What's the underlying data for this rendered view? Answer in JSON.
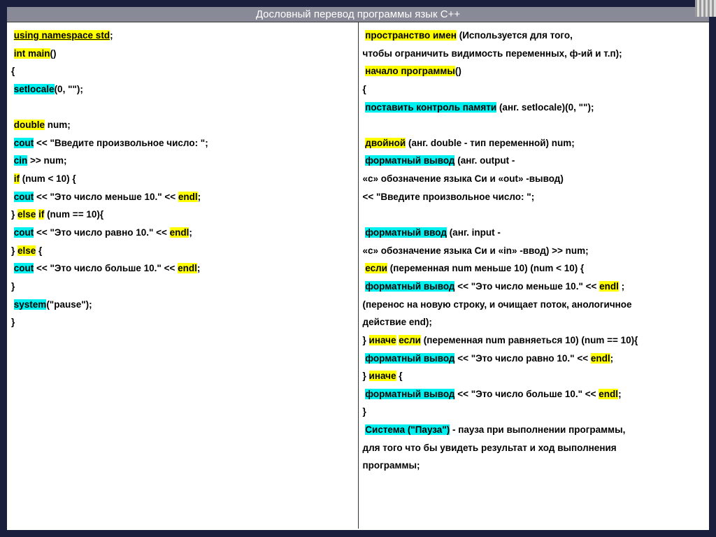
{
  "header": {
    "title": "Дословный перевод программы язык C++"
  },
  "left": {
    "lines": [
      [
        {
          "t": "  ",
          "y": true
        }
      ],
      [
        {
          "t": "  ",
          "y": true
        }
      ],
      [
        {
          "t": " "
        },
        {
          "t": "using namespace std",
          "y": true,
          "b": true,
          "u": true
        },
        {
          "t": ";",
          "b": true
        }
      ],
      [
        {
          "t": " "
        },
        {
          "t": "int main",
          "y": true,
          "b": true
        },
        {
          "t": "()",
          "b": true
        }
      ],
      [
        {
          "t": "{",
          "b": true
        }
      ],
      [
        {
          "t": "  "
        },
        {
          "t": "setlocale",
          "c": true,
          "b": true
        },
        {
          "t": "(0, \"\");",
          "b": true
        }
      ],
      [
        {
          "t": " "
        }
      ],
      [
        {
          "t": " "
        },
        {
          "t": "double",
          "y": true,
          "b": true
        },
        {
          "t": " num;",
          "b": true
        }
      ],
      [
        {
          "t": " "
        },
        {
          "t": "cout",
          "c": true,
          "b": true
        },
        {
          "t": " << \"Введите произвольное число: \";",
          "b": true
        }
      ],
      [
        {
          "t": " "
        },
        {
          "t": "cin",
          "c": true,
          "b": true
        },
        {
          "t": " >> num;",
          "b": true
        }
      ],
      [
        {
          "t": " "
        },
        {
          "t": "if",
          "y": true,
          "b": true
        },
        {
          "t": " (num < 10) {",
          "b": true
        }
      ],
      [
        {
          "t": " "
        },
        {
          "t": "cout",
          "c": true,
          "b": true
        },
        {
          "t": " << \"Это число меньше 10.\" << ",
          "b": true
        },
        {
          "t": "endl",
          "y": true,
          "b": true
        },
        {
          "t": ";",
          "b": true
        }
      ],
      [
        {
          "t": "} ",
          "b": true
        },
        {
          "t": "else",
          "y": true,
          "b": true
        },
        {
          "t": " ",
          "b": true
        },
        {
          "t": "if",
          "y": true,
          "b": true
        },
        {
          "t": " (num == 10){",
          "b": true
        }
      ],
      [
        {
          "t": " "
        },
        {
          "t": "cout",
          "c": true,
          "b": true
        },
        {
          "t": " << \"Это число равно 10.\" << ",
          "b": true
        },
        {
          "t": "endl",
          "y": true,
          "b": true
        },
        {
          "t": ";",
          "b": true
        }
      ],
      [
        {
          "t": "} ",
          "b": true
        },
        {
          "t": "else",
          "y": true,
          "b": true
        },
        {
          "t": " {",
          "b": true
        }
      ],
      [
        {
          "t": "   "
        },
        {
          "t": "cout",
          "c": true,
          "b": true
        },
        {
          "t": " << \"Это число больше 10.\" << ",
          "b": true
        },
        {
          "t": "endl",
          "y": true,
          "b": true
        },
        {
          "t": ";",
          "b": true
        }
      ],
      [
        {
          "t": "}",
          "b": true
        }
      ],
      [
        {
          "t": "  "
        },
        {
          "t": "system",
          "c": true,
          "b": true
        },
        {
          "t": "(\"pause\");",
          "b": true
        }
      ],
      [
        {
          "t": "}",
          "b": true
        }
      ]
    ]
  },
  "right": {
    "lines": [
      [
        {
          "t": "  ",
          "y": true
        }
      ],
      [
        {
          "t": " "
        },
        {
          "t": "пространство имен",
          "y": true,
          "b": true
        },
        {
          "t": " (Используется для того,",
          "b": true
        }
      ],
      [
        {
          "t": " чтобы ограничить видимость переменных, ф-ий и т.п);",
          "b": true
        }
      ],
      [
        {
          "t": " "
        },
        {
          "t": "начало программы",
          "y": true,
          "b": true
        },
        {
          "t": "()",
          "b": true
        }
      ],
      [
        {
          "t": "{",
          "b": true
        }
      ],
      [
        {
          "t": "  "
        },
        {
          "t": "поставить контроль памяти",
          "c": true,
          "b": true
        },
        {
          "t": " (анг. setlocale)(0, \"\");",
          "b": true
        }
      ],
      [
        {
          "t": " "
        }
      ],
      [
        {
          "t": " "
        },
        {
          "t": "двойной",
          "y": true,
          "b": true
        },
        {
          "t": " (анг. double - тип переменной) num;",
          "b": true
        }
      ],
      [
        {
          "t": "  "
        },
        {
          "t": "форматный вывод",
          "c": true,
          "b": true
        },
        {
          "t": " (анг. output -",
          "b": true
        }
      ],
      [
        {
          "t": " «с» обозначение языка Си и «out» -вывод)",
          "b": true
        }
      ],
      [
        {
          "t": " << \"Введите произвольное число: \";",
          "b": true
        }
      ],
      [
        {
          "t": " "
        }
      ],
      [
        {
          "t": " "
        },
        {
          "t": "форматный ввод",
          "c": true,
          "b": true
        },
        {
          "t": " (анг. input -",
          "b": true
        }
      ],
      [
        {
          "t": " «с» обозначение языка Си и «in» -ввод) >> num;",
          "b": true
        }
      ],
      [
        {
          "t": "  "
        },
        {
          "t": "если",
          "y": true,
          "b": true
        },
        {
          "t": " (переменная num меньше 10) (num < 10) {",
          "b": true
        }
      ],
      [
        {
          "t": "  "
        },
        {
          "t": "форматный вывод",
          "c": true,
          "b": true
        },
        {
          "t": " << \"Это число меньше 10.\" << ",
          "b": true
        },
        {
          "t": "endl",
          "y": true,
          "b": true
        },
        {
          "t": " ;",
          "b": true
        }
      ],
      [
        {
          "t": "(перенос на новую строку, и очищает поток, анологичное",
          "b": true
        }
      ],
      [
        {
          "t": "действие end);",
          "b": true
        }
      ],
      [
        {
          "t": " } ",
          "b": true
        },
        {
          "t": "иначе",
          "y": true,
          "b": true
        },
        {
          "t": " ",
          "b": true
        },
        {
          "t": "если",
          "y": true,
          "b": true
        },
        {
          "t": " (переменная num равняеться 10) (num == 10){",
          "b": true
        }
      ],
      [
        {
          "t": "   "
        },
        {
          "t": "форматный вывод",
          "c": true,
          "b": true
        },
        {
          "t": " << \"Это число равно 10.\" << ",
          "b": true
        },
        {
          "t": "endl",
          "y": true,
          "b": true
        },
        {
          "t": ";",
          "b": true
        }
      ],
      [
        {
          "t": "} ",
          "b": true
        },
        {
          "t": "иначе",
          "y": true,
          "b": true
        },
        {
          "t": " {",
          "b": true
        }
      ],
      [
        {
          "t": "   "
        },
        {
          "t": "форматный вывод",
          "c": true,
          "b": true
        },
        {
          "t": " << \"Это число больше 10.\" << ",
          "b": true
        },
        {
          "t": "endl",
          "y": true,
          "b": true
        },
        {
          "t": ";",
          "b": true
        }
      ],
      [
        {
          "t": "}",
          "b": true
        }
      ],
      [
        {
          "t": "   "
        },
        {
          "t": "Система (\"Пауза\")",
          "c": true,
          "b": true
        },
        {
          "t": " - пауза при выполнении программы,",
          "b": true
        }
      ],
      [
        {
          "t": "для того что бы увидеть результат и ход выполнения",
          "b": true
        }
      ],
      [
        {
          "t": "программы;",
          "b": true
        }
      ]
    ]
  }
}
